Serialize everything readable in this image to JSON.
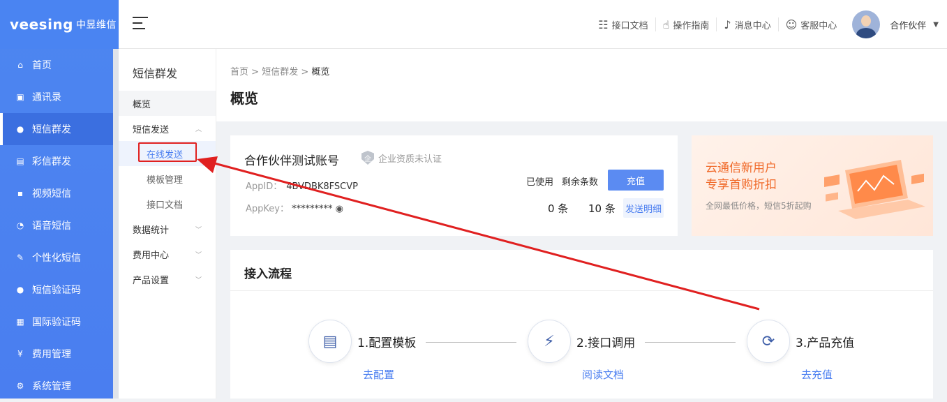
{
  "brand": {
    "logo_text": "veesing",
    "logo_cn": "中昱维信"
  },
  "sidebar": {
    "items": [
      {
        "label": "首页",
        "icon": "home-icon"
      },
      {
        "label": "通讯录",
        "icon": "contacts-icon"
      },
      {
        "label": "短信群发",
        "icon": "sms-icon",
        "active": true
      },
      {
        "label": "彩信群发",
        "icon": "mms-icon"
      },
      {
        "label": "视频短信",
        "icon": "video-sms-icon"
      },
      {
        "label": "语音短信",
        "icon": "voice-sms-icon"
      },
      {
        "label": "个性化短信",
        "icon": "custom-sms-icon"
      },
      {
        "label": "短信验证码",
        "icon": "sms-code-icon"
      },
      {
        "label": "国际验证码",
        "icon": "intl-code-icon"
      },
      {
        "label": "费用管理",
        "icon": "yen-icon"
      },
      {
        "label": "系统管理",
        "icon": "gear-icon"
      }
    ]
  },
  "topbar": {
    "links": [
      {
        "label": "接口文档",
        "icon": "doc-icon"
      },
      {
        "label": "操作指南",
        "icon": "hand-icon"
      },
      {
        "label": "消息中心",
        "icon": "bell-icon"
      },
      {
        "label": "客服中心",
        "icon": "support-icon"
      }
    ],
    "user_name": "合作伙伴"
  },
  "subnav": {
    "title": "短信群发",
    "overview": "概览",
    "send_group": "短信发送",
    "online_send": "在线发送",
    "template_mgmt": "模板管理",
    "api_docs": "接口文档",
    "stats": "数据统计",
    "billing": "费用中心",
    "product_settings": "产品设置"
  },
  "breadcrumb": {
    "home": "首页",
    "section": "短信群发",
    "current": "概览"
  },
  "page_title": "概览",
  "account": {
    "name": "合作伙伴测试账号",
    "cert_status": "企业资质未认证",
    "appid_label": "AppID：",
    "appid_value": "4BVDBK8FSCVP",
    "appkey_label": "AppKey：",
    "appkey_value": "*********",
    "used_label": "已使用",
    "remaining_label": "剩余条数",
    "used_value": "0 条",
    "remaining_value": "10 条",
    "charge_button": "充值",
    "detail_button": "发送明细"
  },
  "promo": {
    "line1": "云通信新用户",
    "line2": "专享首购折扣",
    "line3": "全网最低价格，短信5折起购"
  },
  "flow": {
    "title": "接入流程",
    "steps": [
      {
        "label": "1.配置模板",
        "link": "去配置",
        "icon": "template-doc-icon"
      },
      {
        "label": "2.接口调用",
        "link": "阅读文档",
        "icon": "plug-icon"
      },
      {
        "label": "3.产品充值",
        "link": "去充值",
        "icon": "recharge-icon"
      }
    ]
  },
  "colors": {
    "primary": "#4a7ef0",
    "accent_orange": "#f06a2a",
    "annotation_red": "#e02020"
  }
}
